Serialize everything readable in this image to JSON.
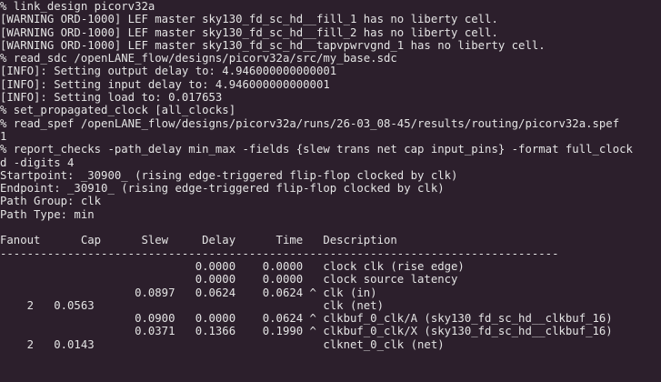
{
  "terminal": {
    "lines": [
      "% link_design picorv32a",
      "[WARNING ORD-1000] LEF master sky130_fd_sc_hd__fill_1 has no liberty cell.",
      "[WARNING ORD-1000] LEF master sky130_fd_sc_hd__fill_2 has no liberty cell.",
      "[WARNING ORD-1000] LEF master sky130_fd_sc_hd__tapvpwrvgnd_1 has no liberty cell.",
      "% read_sdc /openLANE_flow/designs/picorv32a/src/my_base.sdc",
      "[INFO]: Setting output delay to: 4.946000000000001",
      "[INFO]: Setting input delay to: 4.946000000000001",
      "[INFO]: Setting load to: 0.017653",
      "% set_propagated_clock [all_clocks]",
      "% read_spef /openLANE_flow/designs/picorv32a/runs/26-03_08-45/results/routing/picorv32a.spef",
      "1",
      "% report_checks -path_delay min_max -fields {slew trans net cap input_pins} -format full_clock",
      "d -digits 4",
      "Startpoint: _30900_ (rising edge-triggered flip-flop clocked by clk)",
      "Endpoint: _30910_ (rising edge-triggered flip-flop clocked by clk)",
      "Path Group: clk",
      "Path Type: min",
      "",
      "Fanout      Cap      Slew     Delay      Time   Description",
      "-----------------------------------------------------------------------------------",
      "                             0.0000    0.0000   clock clk (rise edge)",
      "                             0.0000    0.0000   clock source latency",
      "                    0.0897   0.0624    0.0624 ^ clk (in)",
      "    2   0.0563                                  clk (net)",
      "                    0.0900   0.0000    0.0624 ^ clkbuf_0_clk/A (sky130_fd_sc_hd__clkbuf_16)",
      "                    0.0371   0.1366    0.1990 ^ clkbuf_0_clk/X (sky130_fd_sc_hd__clkbuf_16)",
      "    2   0.0143                                  clknet_0_clk (net)"
    ]
  }
}
